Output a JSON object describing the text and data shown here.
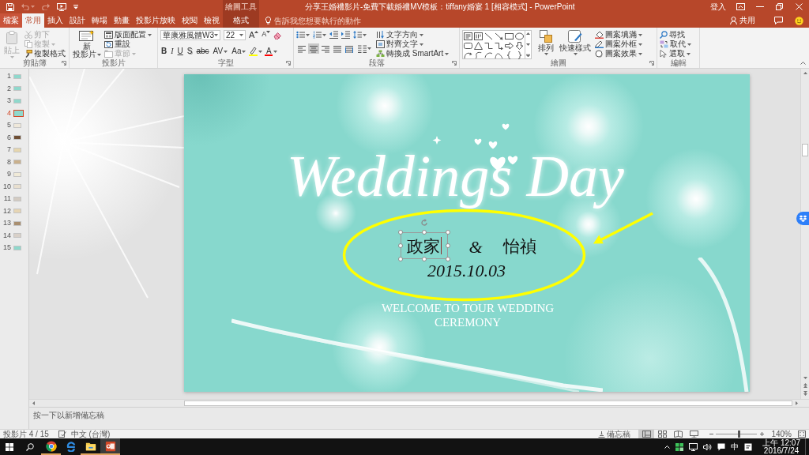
{
  "window": {
    "title": "分享王婚禮影片-免費下載婚禮MV模板：tiffany婚宴 1 [相容模式] - PowerPoint",
    "contextual_group": "繪圖工具",
    "sign_in": "登入",
    "quick_access": [
      {
        "kind": "save",
        "disabled": false
      },
      {
        "kind": "undo",
        "disabled": true
      },
      {
        "kind": "redo",
        "disabled": true
      },
      {
        "kind": "from_beginning",
        "disabled": false
      }
    ]
  },
  "tabs": [
    {
      "label": "檔案",
      "kind": "file",
      "selected": false
    },
    {
      "label": "常用",
      "kind": "normal",
      "selected": true
    },
    {
      "label": "插入",
      "kind": "normal",
      "selected": false
    },
    {
      "label": "設計",
      "kind": "normal",
      "selected": false
    },
    {
      "label": "轉場",
      "kind": "normal",
      "selected": false
    },
    {
      "label": "動畫",
      "kind": "normal",
      "selected": false
    },
    {
      "label": "投影片放映",
      "kind": "normal",
      "selected": false
    },
    {
      "label": "校閱",
      "kind": "normal",
      "selected": false
    },
    {
      "label": "檢視",
      "kind": "normal",
      "selected": false
    },
    {
      "label": "格式",
      "kind": "contextual",
      "selected": false
    }
  ],
  "tell_me": {
    "placeholder": "告訴我您想要執行的動作"
  },
  "share": {
    "label": "共用"
  },
  "ribbon": {
    "clipboard": {
      "label": "剪貼簿",
      "buttons": [
        {
          "kind": "paste",
          "label": "貼上",
          "disabled": true
        },
        {
          "kind": "cut",
          "label": "剪下",
          "disabled": true
        },
        {
          "kind": "copy",
          "label": "複製",
          "disabled": true
        },
        {
          "kind": "format_painter",
          "label": "複製格式",
          "disabled": false
        }
      ]
    },
    "slides": {
      "label": "投影片",
      "buttons": [
        {
          "kind": "new_slide",
          "label": "新投影片",
          "disabled": false
        },
        {
          "kind": "layout",
          "label": "版面配置",
          "disabled": false
        },
        {
          "kind": "reset",
          "label": "重設",
          "disabled": false
        },
        {
          "kind": "section",
          "label": "章節",
          "disabled": true
        }
      ]
    },
    "font": {
      "label": "字型",
      "font_name": "華康雅風體W3",
      "font_size": "22",
      "size_buttons": [
        {
          "kind": "grow",
          "label": "A"
        },
        {
          "kind": "shrink",
          "label": "A"
        }
      ],
      "format_buttons": [
        {
          "kind": "bold",
          "label": "B"
        },
        {
          "kind": "italic",
          "label": "I"
        },
        {
          "kind": "underline",
          "label": "U"
        },
        {
          "kind": "shadow",
          "label": "S"
        },
        {
          "kind": "strikethrough",
          "label": "abc"
        },
        {
          "kind": "spacing",
          "label": "AV"
        },
        {
          "kind": "case",
          "label": "Aa"
        }
      ],
      "font_color": {
        "label": "A"
      }
    },
    "paragraph": {
      "label": "段落",
      "text_direction": "文字方向",
      "align_text": "對齊文字",
      "smartart": "轉換成 SmartArt",
      "alignment": [
        {
          "kind": "left",
          "selected": false
        },
        {
          "kind": "center",
          "selected": true
        },
        {
          "kind": "right",
          "selected": false
        },
        {
          "kind": "justify",
          "selected": false
        },
        {
          "kind": "distributed",
          "selected": false
        }
      ]
    },
    "drawing": {
      "label": "繪圖",
      "arrange": "排列",
      "quick_styles": "快速樣式",
      "fill": "圖案填滿",
      "outline": "圖案外框",
      "effects": "圖案效果"
    },
    "editing": {
      "label": "編輯",
      "find": "尋找",
      "replace": "取代",
      "select": "選取"
    }
  },
  "thumbnails": [
    {
      "number": "1",
      "selected": false,
      "color": "#8fd8cc"
    },
    {
      "number": "2",
      "selected": false,
      "color": "#8fd8cc"
    },
    {
      "number": "3",
      "selected": false,
      "color": "#8fd8cc"
    },
    {
      "number": "4",
      "selected": true,
      "color": "#8fd8cc"
    },
    {
      "number": "5",
      "selected": false,
      "color": "#efe8da"
    },
    {
      "number": "6",
      "selected": false,
      "color": "#6e4e34"
    },
    {
      "number": "7",
      "selected": false,
      "color": "#e6d6ae"
    },
    {
      "number": "8",
      "selected": false,
      "color": "#c9b08c"
    },
    {
      "number": "9",
      "selected": false,
      "color": "#f0ead8"
    },
    {
      "number": "10",
      "selected": false,
      "color": "#e8dfcf"
    },
    {
      "number": "11",
      "selected": false,
      "color": "#d3cbc2"
    },
    {
      "number": "12",
      "selected": false,
      "color": "#e6d5b4"
    },
    {
      "number": "13",
      "selected": false,
      "color": "#a98f70"
    },
    {
      "number": "14",
      "selected": false,
      "color": "#d8d0c8"
    },
    {
      "number": "15",
      "selected": false,
      "color": "#8fd8cc"
    }
  ],
  "slide": {
    "title_art": "Weddings Day",
    "text_boxes": [
      {
        "kind": "name",
        "text": "政家",
        "selected": true
      },
      {
        "kind": "ampersand",
        "text": "&",
        "selected": false
      },
      {
        "kind": "name",
        "text": "怡禎",
        "selected": false
      }
    ],
    "date": "2015.10.03",
    "welcome": "WELCOME TO TOUR WEDDING CEREMONY"
  },
  "notes": {
    "placeholder": "按一下以新增備忘稿"
  },
  "status_bar": {
    "slide_counter": "投影片 4 / 15",
    "language": "中文 (台灣)",
    "notes_button": "備忘稿",
    "views": [
      {
        "kind": "normal",
        "selected": true
      },
      {
        "kind": "sorter",
        "selected": false
      },
      {
        "kind": "reading",
        "selected": false
      },
      {
        "kind": "slideshow",
        "selected": false
      }
    ],
    "zoom": {
      "level": 0.56,
      "reading": "140%"
    }
  },
  "taskbar": {
    "apps": [
      {
        "kind": "chrome",
        "open": true,
        "active": false
      },
      {
        "kind": "ie",
        "open": false,
        "active": false
      },
      {
        "kind": "explorer",
        "open": true,
        "active": false
      },
      {
        "kind": "powerpoint",
        "open": true,
        "active": true
      }
    ],
    "ime": "中",
    "time": "上午 12:07",
    "date": "2016/7/24"
  }
}
